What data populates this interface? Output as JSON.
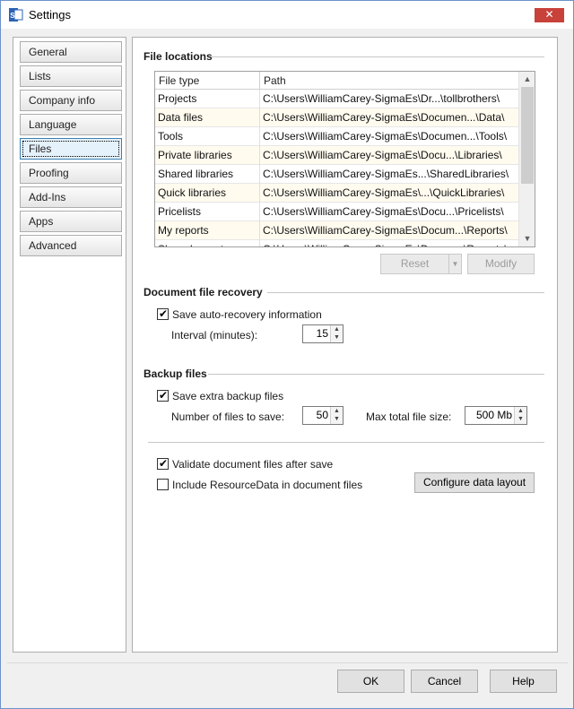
{
  "window": {
    "title": "Settings",
    "close_glyph": "✕",
    "icon": "settings-app-icon"
  },
  "nav": {
    "items": [
      {
        "label": "General"
      },
      {
        "label": "Lists"
      },
      {
        "label": "Company info"
      },
      {
        "label": "Language"
      },
      {
        "label": "Files",
        "active": true
      },
      {
        "label": "Proofing"
      },
      {
        "label": "Add-Ins"
      },
      {
        "label": "Apps"
      },
      {
        "label": "Advanced"
      }
    ]
  },
  "file_locations": {
    "title": "File locations",
    "columns": [
      "File type",
      "Path"
    ],
    "rows": [
      [
        "Projects",
        "C:\\Users\\WilliamCarey-SigmaEs\\Dr...\\tollbrothers\\"
      ],
      [
        "Data files",
        "C:\\Users\\WilliamCarey-SigmaEs\\Documen...\\Data\\"
      ],
      [
        "Tools",
        "C:\\Users\\WilliamCarey-SigmaEs\\Documen...\\Tools\\"
      ],
      [
        "Private libraries",
        "C:\\Users\\WilliamCarey-SigmaEs\\Docu...\\Libraries\\"
      ],
      [
        "Shared libraries",
        "C:\\Users\\WilliamCarey-SigmaEs...\\SharedLibraries\\"
      ],
      [
        "Quick libraries",
        "C:\\Users\\WilliamCarey-SigmaEs\\...\\QuickLibraries\\"
      ],
      [
        "Pricelists",
        "C:\\Users\\WilliamCarey-SigmaEs\\Docu...\\Pricelists\\"
      ],
      [
        "My reports",
        "C:\\Users\\WilliamCarey-SigmaEs\\Docum...\\Reports\\"
      ],
      [
        "Shared reports",
        "C:\\Users\\WilliamCarey-SigmaEs\\Docum...\\Reports\\"
      ]
    ],
    "reset_label": "Reset",
    "modify_label": "Modify"
  },
  "recovery": {
    "title": "Document file recovery",
    "save_auto_label": "Save auto-recovery information",
    "save_auto_checked": true,
    "interval_label": "Interval (minutes):",
    "interval_value": "15"
  },
  "backup": {
    "title": "Backup files",
    "save_extra_label": "Save extra backup files",
    "save_extra_checked": true,
    "num_files_label": "Number of files to save:",
    "num_files_value": "50",
    "max_size_label": "Max total file size:",
    "max_size_value": "500 Mb"
  },
  "misc": {
    "validate_label": "Validate document files after save",
    "validate_checked": true,
    "include_label": "Include ResourceData in document files",
    "include_checked": false,
    "configure_label": "Configure data layout"
  },
  "footer": {
    "ok_label": "OK",
    "cancel_label": "Cancel",
    "help_label": "Help"
  },
  "colors": {
    "accent": "#3c7fb1",
    "close": "#c8413a",
    "row_alt": "#fffbef"
  }
}
